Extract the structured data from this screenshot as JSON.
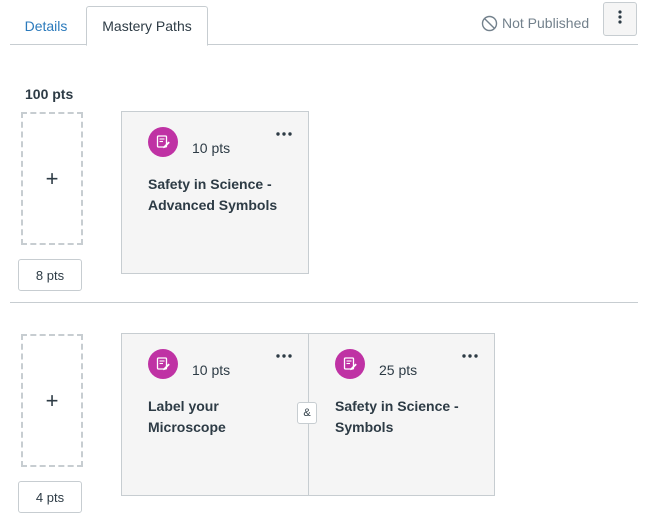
{
  "tabs": [
    {
      "label": "Details"
    },
    {
      "label": "Mastery Paths"
    }
  ],
  "header": {
    "publish_status": "Not Published"
  },
  "ranges": [
    {
      "label": "100 pts",
      "drop_symbol": "+",
      "points_value": "8 pts",
      "assignments": [
        {
          "points": "10 pts",
          "title": "Safety in Science - Advanced Symbols",
          "icon": "quiz-edit-icon"
        }
      ]
    },
    {
      "label": "",
      "drop_symbol": "+",
      "points_value": "4 pts",
      "and_label": "&",
      "assignments": [
        {
          "points": "10 pts",
          "title": "Label your Microscope",
          "icon": "quiz-edit-icon"
        },
        {
          "points": "25 pts",
          "title": "Safety in Science - Symbols",
          "icon": "quiz-edit-icon"
        }
      ]
    }
  ],
  "colors": {
    "link": "#2b7abc",
    "icon_bg": "#bf32a4",
    "border": "#c7cdd1",
    "card_bg": "#f5f5f5",
    "muted": "#73818c"
  }
}
